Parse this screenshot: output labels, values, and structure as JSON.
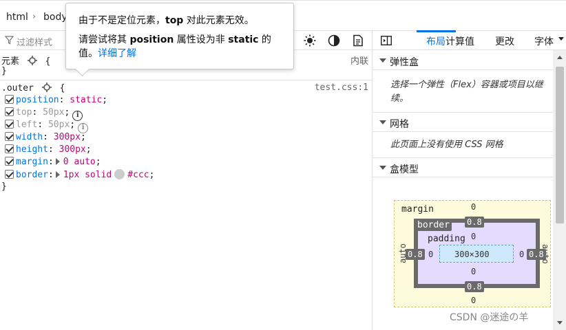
{
  "breadcrumbs": {
    "item1": "html",
    "sep": "›",
    "item2": "body"
  },
  "tooltip": {
    "line1_pre": "由于不是定位元素，",
    "line1_bold": "top",
    "line1_post": " 对此元素无效。",
    "line2_pre": "请尝试将其 ",
    "line2_bold1": "position",
    "line2_mid": " 属性设为非 ",
    "line2_bold2": "static",
    "line2_post": " 的值。",
    "link": "详细了解"
  },
  "filter": {
    "placeholder": "过滤样式"
  },
  "rules": {
    "element_selector": "元素",
    "open_brace": "{",
    "close_brace": "}",
    "element_source": "内联",
    "outer_selector": ".outer",
    "outer_source": "test.css:1",
    "declarations": [
      {
        "name": "position",
        "value": "static"
      },
      {
        "name": "top",
        "value": "50px"
      },
      {
        "name": "left",
        "value": "50px"
      },
      {
        "name": "width",
        "value": "300px"
      },
      {
        "name": "height",
        "value": "300px"
      },
      {
        "name": "margin",
        "value": "0 auto"
      },
      {
        "name": "border",
        "value": "1px solid",
        "color_value": "#ccc"
      }
    ]
  },
  "right_tabs": {
    "layout": "布局",
    "computed": "计算值",
    "changes": "更改",
    "fonts": "字体"
  },
  "sections": {
    "flex": {
      "title": "弹性盒",
      "body": "选择一个弹性（Flex）容器或项目以继续。"
    },
    "grid": {
      "title": "网格",
      "body": "此页面上没有使用 CSS 网格"
    },
    "boxmodel": {
      "title": "盒模型"
    }
  },
  "box_model": {
    "margin_label": "margin",
    "border_label": "border",
    "padding_label": "padding",
    "content": "300×300",
    "margin_top": "0",
    "margin_bottom": "0",
    "margin_left": "auto",
    "margin_right": "auto",
    "border_top": "0.8",
    "border_bottom": "0.8",
    "border_left": "0.8",
    "border_right": "0.8",
    "padding_top": "0",
    "padding_bottom": "0",
    "padding_left": "0",
    "padding_right": "0"
  },
  "watermark": "CSDN @迷途の羊",
  "colors": {
    "accent": "#0074e8",
    "prop_name": "#0074e8",
    "prop_value": "#c4007a",
    "swatch": "#cccccc"
  }
}
